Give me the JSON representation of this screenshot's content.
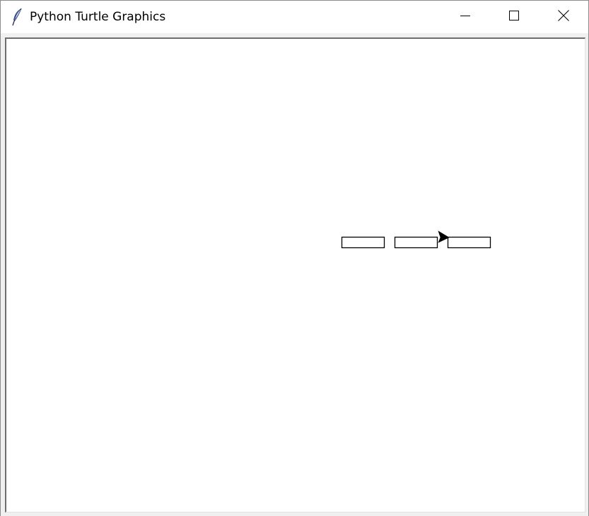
{
  "window": {
    "title": "Python Turtle Graphics",
    "icon": "feather-icon",
    "controls": {
      "minimize": "minimize-icon",
      "maximize": "maximize-icon",
      "close": "close-icon"
    }
  },
  "canvas": {
    "background": "#ffffff",
    "shapes": [
      {
        "kind": "rectangle",
        "stroke": "#000000",
        "fill": "none"
      },
      {
        "kind": "rectangle",
        "stroke": "#000000",
        "fill": "none"
      },
      {
        "kind": "rectangle",
        "stroke": "#000000",
        "fill": "none"
      }
    ],
    "turtle": {
      "shape": "arrow",
      "heading": "right",
      "color": "#000000"
    }
  }
}
